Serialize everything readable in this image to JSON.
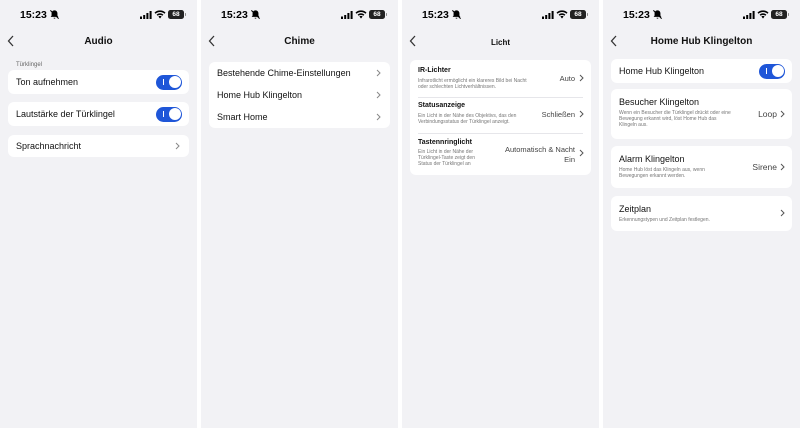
{
  "status": {
    "time": "15:23",
    "battery": "68"
  },
  "colors": {
    "accent": "#1f56d8",
    "background": "#f2f2f5"
  },
  "audio": {
    "title": "Audio",
    "section": "Türklingel",
    "rows": [
      {
        "label": "Ton aufnehmen",
        "toggle": true
      },
      {
        "label": "Lautstärke der Türklingel",
        "toggle": true
      },
      {
        "label": "Sprachnachricht"
      }
    ]
  },
  "chime": {
    "title": "Chime",
    "rows": [
      {
        "label": "Bestehende Chime-Einstellungen"
      },
      {
        "label": "Home Hub Klingelton"
      },
      {
        "label": "Smart Home"
      }
    ]
  },
  "licht": {
    "title": "Licht",
    "rows": [
      {
        "label": "IR-Lichter",
        "desc1": "Infrarotlicht ermöglicht ein klareres Bild bei Nacht",
        "desc2": "oder schlechten Lichtverhältnissen.",
        "value": "Auto"
      },
      {
        "label": "Statusanzeige",
        "desc1": "Ein Licht in der Nähe des Objektivs, das den",
        "desc2": "Verbindungsstatus der Türklingel anzeigt.",
        "value": "Schließen"
      },
      {
        "label": "Tastennringlicht",
        "desc1": "Ein Licht in der Nähe der",
        "desc2": "Türklingel-Taste zeigt den",
        "desc3": "Status der Türklingel an",
        "value1": "Automatisch & Nacht",
        "value2": "Ein"
      }
    ]
  },
  "hub": {
    "title": "Home Hub Klingelton",
    "toggle_row": {
      "label": "Home Hub Klingelton",
      "toggle": true
    },
    "visitor": {
      "label": "Besucher Klingelton",
      "desc1": "Wenn ein Besucher die Türklingel drückt oder eine",
      "desc2": "Bewegung erkannt wird, löst Home Hub das",
      "desc3": "Klingeln aus.",
      "value": "Loop"
    },
    "alarm": {
      "label": "Alarm Klingelton",
      "desc1": "Home Hub löst das Klingeln aus, wenn",
      "desc2": "Bewegungen erkannt werden.",
      "value": "Sirene"
    },
    "schedule": {
      "label": "Zeitplan",
      "desc1": "Erkennungstypen und Zeitplan festlegen."
    }
  }
}
